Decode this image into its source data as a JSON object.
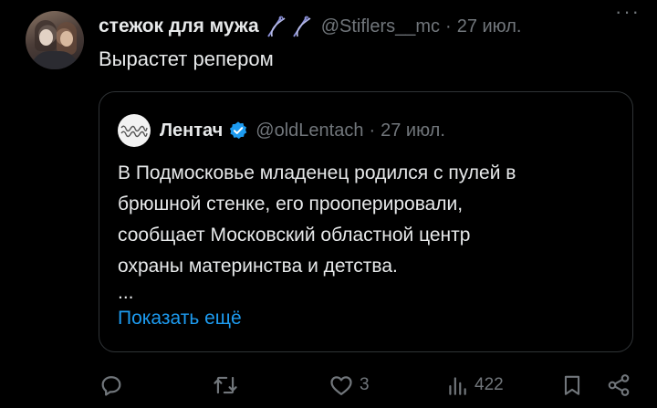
{
  "author": {
    "name": "стежок для мужа",
    "handle": "@Stiflers__mc",
    "date": "27 июл.",
    "decoration_icons": [
      "needle-thread-icon",
      "needle-thread-icon"
    ]
  },
  "tweet": {
    "text": "Вырастет репером"
  },
  "quote": {
    "name": "Лентач",
    "handle": "@oldLentach",
    "separator": "·",
    "date": "27 июл.",
    "verified": true,
    "body_lines": [
      "В Подмосковье младенец родился с пулей в",
      "брюшной стенке, его прооперировали,",
      "сообщает Московский областной центр",
      "охраны материнства и детства."
    ],
    "ellipsis": "...",
    "show_more": "Показать ещё"
  },
  "actions": {
    "reply_count": "",
    "retweet_count": "",
    "like_count": "3",
    "views_count": "422"
  },
  "colors": {
    "background": "#000000",
    "text": "#e7e9ea",
    "muted": "#71767b",
    "link": "#1d9bf0",
    "border": "#2f3336",
    "verified": "#1d9bf0"
  },
  "ui": {
    "separator": "·",
    "more_glyph": "···"
  }
}
